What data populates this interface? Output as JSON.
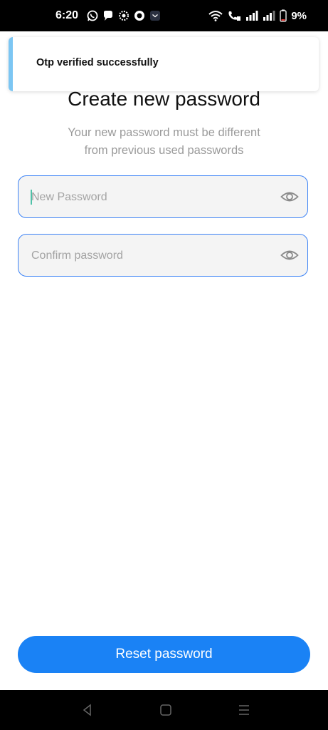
{
  "status_bar": {
    "time": "6:20",
    "battery": "9%",
    "notification_icons": [
      "whatsapp-icon",
      "chat-icon",
      "sync-icon",
      "record-icon",
      "mail-icon"
    ],
    "system_icons": [
      "wifi-icon",
      "volte-call-icon",
      "signal-icon",
      "signal-icon",
      "battery-icon"
    ]
  },
  "toast": {
    "message": "Otp verified successfully",
    "accent": "#7cc6f3"
  },
  "page": {
    "title": "Create new password",
    "subtitle_line1": "Your new password must be different",
    "subtitle_line2": "from previous used passwords"
  },
  "form": {
    "new_password": {
      "placeholder": "New Password",
      "value": ""
    },
    "confirm_password": {
      "placeholder": "Confirm password",
      "value": ""
    },
    "field_border": "#3b82f6"
  },
  "actions": {
    "reset_label": "Reset password",
    "button_color": "#1a82f5"
  },
  "nav_bar": {
    "buttons": [
      "back-icon",
      "home-icon",
      "recents-icon"
    ]
  }
}
